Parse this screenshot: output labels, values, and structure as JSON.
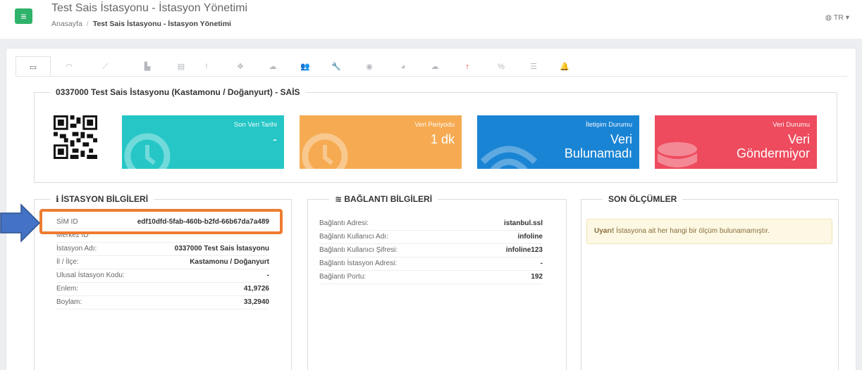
{
  "header": {
    "menu_icon": "≡",
    "title": "Test Sais İstasyonu - İstasyon Yönetimi",
    "breadcrumb_home": "Anasayfa",
    "breadcrumb_sep": "/",
    "breadcrumb_current": "Test Sais İstasyonu - İstasyon Yönetimi",
    "lang": "TR"
  },
  "tabs": [
    {
      "icon": "laptop-icon",
      "glyph": "▭"
    },
    {
      "icon": "dashboard-icon",
      "glyph": "◠"
    },
    {
      "icon": "line-chart-icon",
      "glyph": "⟋"
    },
    {
      "icon": "bar-chart-icon",
      "glyph": "▙"
    },
    {
      "icon": "table-icon",
      "glyph": "▤"
    },
    {
      "icon": "exclamation-icon",
      "glyph": "!"
    },
    {
      "icon": "move-icon",
      "glyph": "✥"
    },
    {
      "icon": "cloud-upload-icon",
      "glyph": "☁"
    },
    {
      "icon": "users-icon",
      "glyph": "👥"
    },
    {
      "icon": "wrench-icon",
      "glyph": "🔧"
    },
    {
      "icon": "crosshair-icon",
      "glyph": "◉"
    },
    {
      "icon": "compass-icon",
      "glyph": "◕"
    },
    {
      "icon": "cloud-icon",
      "glyph": "☁"
    },
    {
      "icon": "arrow-up-icon",
      "glyph": "↑"
    },
    {
      "icon": "percent-icon",
      "glyph": "%"
    },
    {
      "icon": "list-icon",
      "glyph": "☰"
    },
    {
      "icon": "bell-icon",
      "glyph": "🔔"
    }
  ],
  "station_title": "0337000 Test Sais İstasyonu (Kastamonu / Doğanyurt) - SAİS",
  "tiles": [
    {
      "label": "Son Veri Tarihi",
      "value": "-",
      "color": "#26c6c6",
      "icon": "clock-icon"
    },
    {
      "label": "Veri Periyodu",
      "value": "1 dk",
      "color": "#f6ab52",
      "icon": "clock-icon"
    },
    {
      "label": "İletişim Durumu",
      "value_line1": "Veri",
      "value_line2": "Bulunamadı",
      "color": "#1a84d4",
      "icon": "wifi-icon"
    },
    {
      "label": "Veri Durumu",
      "value_line1": "Veri",
      "value_line2": "Göndermiyor",
      "color": "#ee4b5e",
      "icon": "database-icon"
    }
  ],
  "station_info": {
    "title": "İSTASYON BİLGİLERİ",
    "rows": [
      {
        "k": "SİM ID",
        "v": "edf10dfd-5fab-460b-b2fd-66b67da7a489"
      },
      {
        "k": "Merkez ID",
        "v": ""
      },
      {
        "k": "İstasyon Adı:",
        "v": "0337000 Test Sais İstasyonu"
      },
      {
        "k": "İl / İlçe:",
        "v": "Kastamonu / Doğanyurt"
      },
      {
        "k": "Ulusal İstasyon Kodu:",
        "v": "-"
      },
      {
        "k": "Enlem:",
        "v": "41,9726"
      },
      {
        "k": "Boylam:",
        "v": "33,2940"
      }
    ]
  },
  "connection_info": {
    "title": "BAĞLANTI BİLGİLERİ",
    "rows": [
      {
        "k": "Bağlantı Adresi:",
        "v": "istanbul.ssl"
      },
      {
        "k": "Bağlantı Kullanıcı Adı:",
        "v": "infoline"
      },
      {
        "k": "Bağlantı Kullanıcı Şifresi:",
        "v": "infoline123"
      },
      {
        "k": "Bağlantı İstasyon Adresi:",
        "v": "-"
      },
      {
        "k": "Bağlantı Portu:",
        "v": "192"
      }
    ]
  },
  "last_measurements": {
    "title": "SON ÖLÇÜMLER",
    "alert_strong": "Uyarı!",
    "alert_text": " İstasyona ait her hangi bir ölçüm bulunamamıştır."
  },
  "colors": {
    "accent": "#2fb36b",
    "highlight": "#ed7d31",
    "arrow": "#4472c4"
  }
}
